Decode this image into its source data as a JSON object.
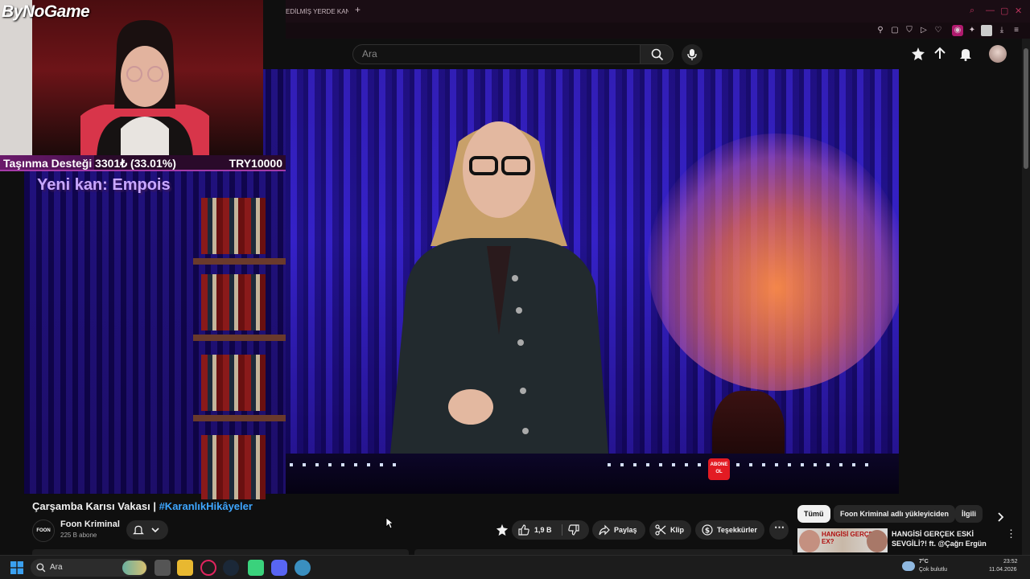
{
  "browser": {
    "tab_title": "EDİLMİŞ YERDE KAN",
    "new_tab": "+"
  },
  "youtube": {
    "search_placeholder": "Ara",
    "video": {
      "title_main": "Çarşamba Karısı Vakası | ",
      "title_hashtag": "#KaranlıkHikâyeler",
      "channel_logo": "FOON",
      "channel_name": "Foon Kriminal",
      "subscribers": "225 B abone",
      "likes": "1,9 B",
      "share_label": "Paylaş",
      "clip_label": "Klip",
      "thanks_label": "Teşekkürler",
      "watermark": "ABONE OL"
    },
    "chips": [
      "Tümü",
      "Foon Kriminal adlı yükleyiciden",
      "İlgili"
    ],
    "recommendation": {
      "thumb_text": "HANGİSİ GERÇEK EX?",
      "title": "HANGİSİ GERÇEK ESKİ SEVGİLİ?! ft. @Çağrı Ergün"
    }
  },
  "stream_overlay": {
    "logo": "ByNoGame",
    "donation_label": "Taşınma Desteği 3301₺ (33.01%)",
    "donation_goal": "TRY10000",
    "donation_progress": 0.3301,
    "new_subscriber": "Yeni kan: Empois"
  },
  "taskbar": {
    "search_placeholder": "Ara",
    "weather_temp": "7°C",
    "weather_desc": "Çok bulutlu",
    "time": "23:52",
    "date": "11.04.2026"
  }
}
